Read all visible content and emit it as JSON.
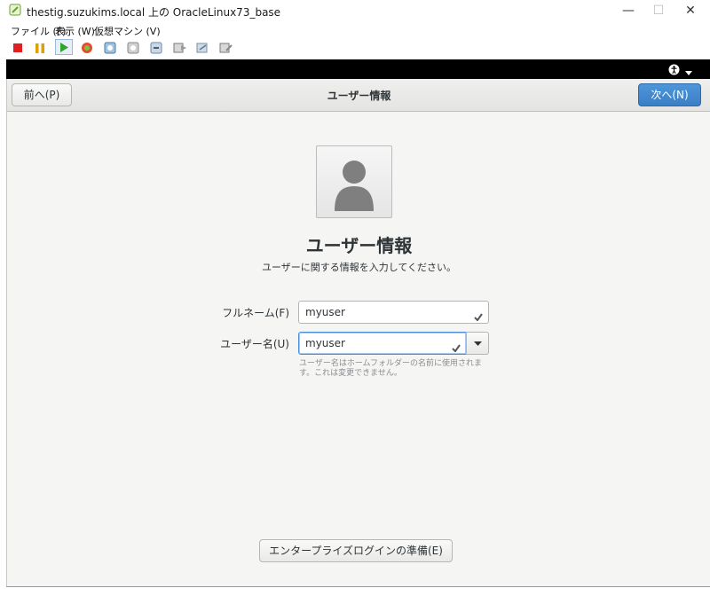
{
  "window": {
    "title": "thestig.suzukims.local 上の OracleLinux73_base",
    "controls": {
      "minimize": "—",
      "maximize": "☐",
      "close": "✕"
    }
  },
  "menubar": {
    "items": [
      "ファイル (F)",
      "表示 (W)",
      "仮想マシン (V)"
    ]
  },
  "toolbar": {
    "icons": [
      "stop-icon",
      "pause-icon",
      "play-icon",
      "reset-icon",
      "snapshot-icon",
      "snapshot-manager-icon",
      "revert-icon",
      "console-icon",
      "usb-icon",
      "settings-icon"
    ]
  },
  "vm_topbar": {
    "icons": [
      "accessibility-icon",
      "menu-arrow-icon"
    ]
  },
  "header": {
    "prev_label": "前へ(P)",
    "title": "ユーザー情報",
    "next_label": "次へ(N)"
  },
  "main": {
    "title": "ユーザー情報",
    "subtitle": "ユーザーに関する情報を入力してください。",
    "fullname_label": "フルネーム(F)",
    "fullname_value": "myuser",
    "username_label": "ユーザー名(U)",
    "username_value": "myuser",
    "username_hint": "ユーザー名はホームフォルダーの名前に使用されます。これは変更できません。",
    "enterprise_login_label": "エンタープライズログインの準備(E)"
  },
  "colors": {
    "accent": "#3a7fc6",
    "background": "#f5f5f4",
    "topbar": "#000000"
  }
}
